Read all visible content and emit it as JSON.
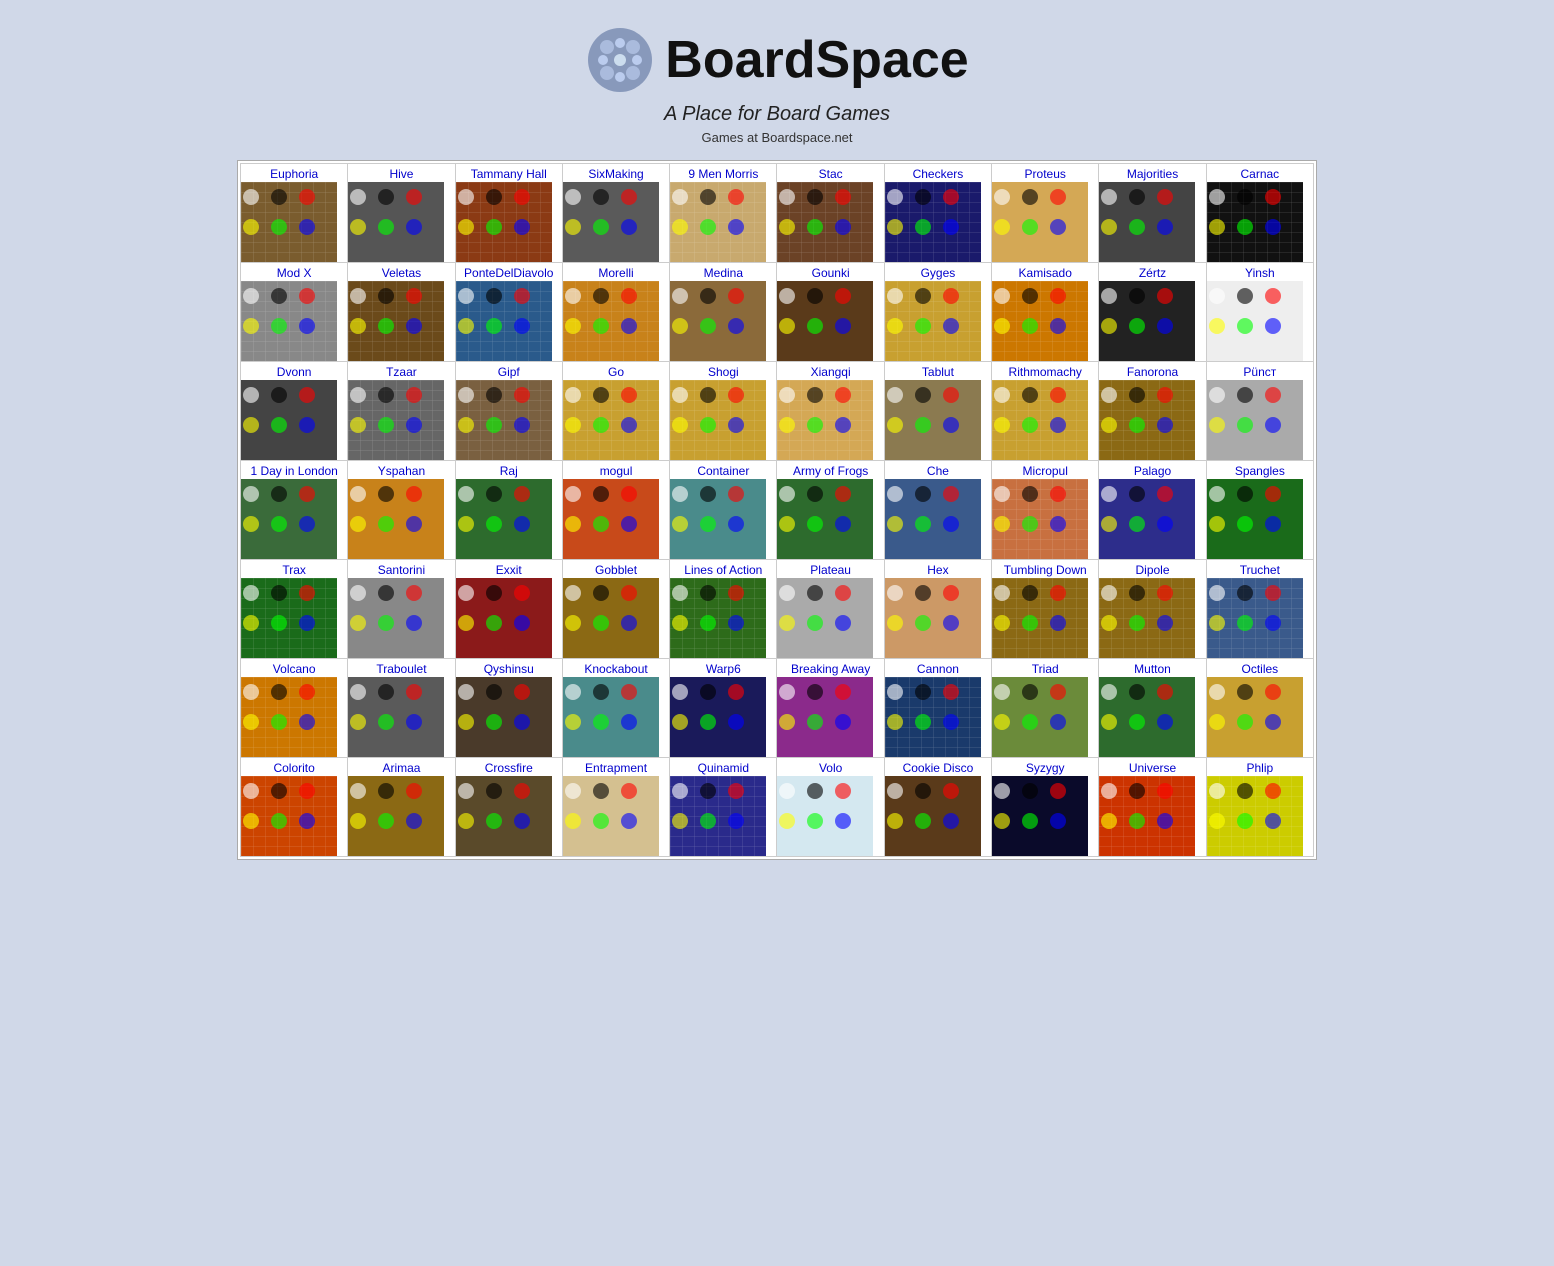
{
  "header": {
    "site_title": "BoardSpace",
    "tagline": "A Place for Board Games",
    "subtitle": "Games at Boardspace.net"
  },
  "games": [
    [
      {
        "name": "Euphoria",
        "bg": "#7a5c2e",
        "pattern": true
      },
      {
        "name": "Hive",
        "bg": "#555",
        "pattern": false
      },
      {
        "name": "Tammany Hall",
        "bg": "#8B3a14",
        "pattern": true
      },
      {
        "name": "SixMaking",
        "bg": "#5a5a5a",
        "pattern": false
      },
      {
        "name": "9 Men Morris",
        "bg": "#c8a96e",
        "pattern": true
      },
      {
        "name": "Stac",
        "bg": "#6b4226",
        "pattern": true
      },
      {
        "name": "Checkers",
        "bg": "#1a1a6b",
        "pattern": true
      },
      {
        "name": "Proteus",
        "bg": "#d4a855",
        "pattern": false
      },
      {
        "name": "Majorities",
        "bg": "#444",
        "pattern": false
      },
      {
        "name": "Carnac",
        "bg": "#111",
        "pattern": true
      }
    ],
    [
      {
        "name": "Mod X",
        "bg": "#888",
        "pattern": true
      },
      {
        "name": "Veletas",
        "bg": "#6b4a1a",
        "pattern": true
      },
      {
        "name": "PonteDelDiavolo",
        "bg": "#2a5a8b",
        "pattern": true
      },
      {
        "name": "Morelli",
        "bg": "#c8821a",
        "pattern": true
      },
      {
        "name": "Medina",
        "bg": "#8b6a3a",
        "pattern": false
      },
      {
        "name": "Gounki",
        "bg": "#5a3a1a",
        "pattern": false
      },
      {
        "name": "Gyges",
        "bg": "#c8a030",
        "pattern": true
      },
      {
        "name": "Kamisado",
        "bg": "#cc7700",
        "pattern": true
      },
      {
        "name": "Zértz",
        "bg": "#222",
        "pattern": false
      },
      {
        "name": "Yinsh",
        "bg": "#eee",
        "pattern": false
      }
    ],
    [
      {
        "name": "Dvonn",
        "bg": "#444",
        "pattern": false
      },
      {
        "name": "Tzaar",
        "bg": "#666",
        "pattern": true
      },
      {
        "name": "Gipf",
        "bg": "#7a6040",
        "pattern": true
      },
      {
        "name": "Go",
        "bg": "#c8a030",
        "pattern": true
      },
      {
        "name": "Shogi",
        "bg": "#c8a030",
        "pattern": true
      },
      {
        "name": "Xiangqi",
        "bg": "#d4a855",
        "pattern": true
      },
      {
        "name": "Tablut",
        "bg": "#8b7a50",
        "pattern": false
      },
      {
        "name": "Rithmomachy",
        "bg": "#c8a030",
        "pattern": true
      },
      {
        "name": "Fanorona",
        "bg": "#8b6914",
        "pattern": true
      },
      {
        "name": "Püncт",
        "bg": "#aaa",
        "pattern": false
      }
    ],
    [
      {
        "name": "1 Day in London",
        "bg": "#3a6b3a",
        "pattern": false
      },
      {
        "name": "Yspahan",
        "bg": "#c8821a",
        "pattern": false
      },
      {
        "name": "Raj",
        "bg": "#2d6b2d",
        "pattern": false
      },
      {
        "name": "mogul",
        "bg": "#c84a1a",
        "pattern": false
      },
      {
        "name": "Container",
        "bg": "#4a8b8b",
        "pattern": false
      },
      {
        "name": "Army of Frogs",
        "bg": "#2d6b2d",
        "pattern": false
      },
      {
        "name": "Che",
        "bg": "#3a5a8b",
        "pattern": false
      },
      {
        "name": "Micropul",
        "bg": "#c87040",
        "pattern": true
      },
      {
        "name": "Palago",
        "bg": "#2d2d8b",
        "pattern": false
      },
      {
        "name": "Spangles",
        "bg": "#1a6b1a",
        "pattern": false
      }
    ],
    [
      {
        "name": "Trax",
        "bg": "#1a6b1a",
        "pattern": true
      },
      {
        "name": "Santorini",
        "bg": "#888",
        "pattern": false
      },
      {
        "name": "Exxit",
        "bg": "#8b1a1a",
        "pattern": false
      },
      {
        "name": "Gobblet",
        "bg": "#8b6914",
        "pattern": false
      },
      {
        "name": "Lines of Action",
        "bg": "#2d6b1a",
        "pattern": true
      },
      {
        "name": "Plateau",
        "bg": "#aaa",
        "pattern": false
      },
      {
        "name": "Hex",
        "bg": "#cc9966",
        "pattern": false
      },
      {
        "name": "Tumbling Down",
        "bg": "#8b6914",
        "pattern": true
      },
      {
        "name": "Dipole",
        "bg": "#8b6914",
        "pattern": true
      },
      {
        "name": "Truchet",
        "bg": "#3a5a8b",
        "pattern": true
      }
    ],
    [
      {
        "name": "Volcano",
        "bg": "#cc7700",
        "pattern": true
      },
      {
        "name": "Traboulet",
        "bg": "#5a5a5a",
        "pattern": false
      },
      {
        "name": "Qyshinsu",
        "bg": "#4a3a2a",
        "pattern": false
      },
      {
        "name": "Knockabout",
        "bg": "#4a8b8b",
        "pattern": false
      },
      {
        "name": "Warp6",
        "bg": "#1a1a5a",
        "pattern": false
      },
      {
        "name": "Breaking Away",
        "bg": "#8b2a8b",
        "pattern": false
      },
      {
        "name": "Cannon",
        "bg": "#1a3a6b",
        "pattern": true
      },
      {
        "name": "Triad",
        "bg": "#6b8b3a",
        "pattern": false
      },
      {
        "name": "Mutton",
        "bg": "#2d6b2d",
        "pattern": false
      },
      {
        "name": "Octiles",
        "bg": "#c8a030",
        "pattern": false
      }
    ],
    [
      {
        "name": "Colorito",
        "bg": "#cc4400",
        "pattern": true
      },
      {
        "name": "Arimaa",
        "bg": "#8b6914",
        "pattern": false
      },
      {
        "name": "Crossfire",
        "bg": "#5a4a2a",
        "pattern": false
      },
      {
        "name": "Entrapment",
        "bg": "#d4c090",
        "pattern": false
      },
      {
        "name": "Quinamid",
        "bg": "#2a2a8b",
        "pattern": true
      },
      {
        "name": "Volo",
        "bg": "#d4e8f0",
        "pattern": false
      },
      {
        "name": "Cookie Disco",
        "bg": "#5a3a1a",
        "pattern": false
      },
      {
        "name": "Syzygy",
        "bg": "#0a0a2a",
        "pattern": false
      },
      {
        "name": "Universe",
        "bg": "#cc3300",
        "pattern": true
      },
      {
        "name": "Phlip",
        "bg": "#cccc00",
        "pattern": true
      }
    ]
  ]
}
